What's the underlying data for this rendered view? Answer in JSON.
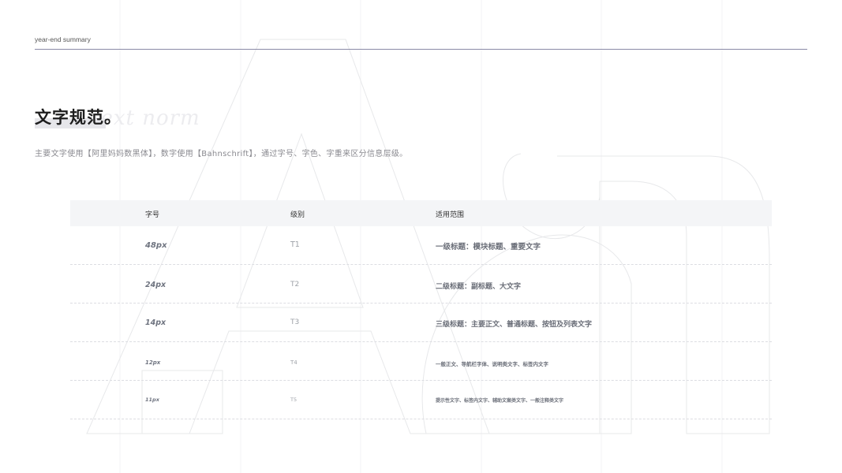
{
  "header": {
    "label": "year-end summary"
  },
  "title": {
    "text": "文字规范。",
    "script": "text norm"
  },
  "description": "主要文字使用【阿里妈妈数黑体】，数字使用【Bahnschrift】，通过字号、字色、字重来区分信息层级。",
  "table": {
    "columns": [
      "字号",
      "级别",
      "适用范围"
    ],
    "rows": [
      {
        "size": "48px",
        "level": "T1",
        "usage": "一级标题：模块标题、重要文字"
      },
      {
        "size": "24px",
        "level": "T2",
        "usage": "二级标题：副标题、大文字"
      },
      {
        "size": "14px",
        "level": "T3",
        "usage": "三级标题：主要正文、普通标题、按钮及列表文字"
      },
      {
        "size": "12px",
        "level": "T4",
        "usage": "一般正文、导航栏字体、说明类文字、标签内文字"
      },
      {
        "size": "11px",
        "level": "T5",
        "usage": "提示性文字、标签内文字、辅助文案类文字、一般注释类文字"
      }
    ]
  },
  "colors": {
    "accent_line": "#8a8aa6",
    "title": "#1e1e1e",
    "header_bg": "#f4f5f7",
    "muted_text": "#8a8a90"
  }
}
